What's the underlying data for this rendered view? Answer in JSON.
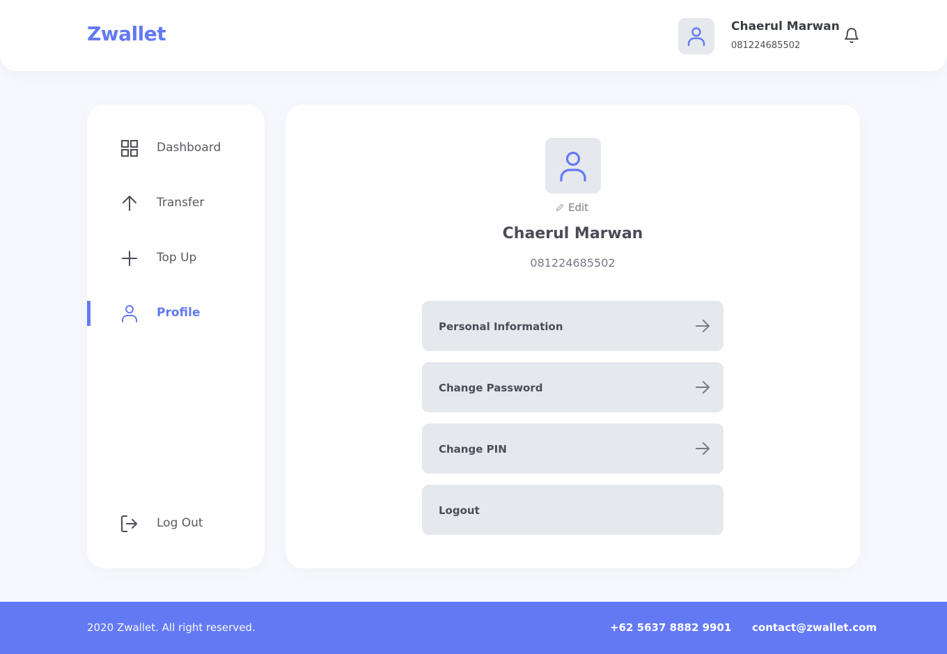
{
  "header": {
    "brand": "Zwallet",
    "user_name": "Chaerul Marwan",
    "user_phone": "081224685502"
  },
  "sidebar": {
    "items": [
      {
        "label": "Dashboard",
        "icon": "grid-icon"
      },
      {
        "label": "Transfer",
        "icon": "arrow-up-icon"
      },
      {
        "label": "Top Up",
        "icon": "plus-icon"
      },
      {
        "label": "Profile",
        "icon": "user-icon",
        "active": true
      }
    ],
    "logout_label": "Log Out"
  },
  "profile": {
    "edit_label": "Edit",
    "name": "Chaerul Marwan",
    "phone": "081224685502",
    "menu": [
      {
        "label": "Personal Information",
        "has_arrow": true
      },
      {
        "label": "Change Password",
        "has_arrow": true
      },
      {
        "label": "Change PIN",
        "has_arrow": true
      },
      {
        "label": "Logout",
        "has_arrow": false
      }
    ]
  },
  "footer": {
    "copyright": "2020 Zwallet. All right reserved.",
    "phone": "+62 5637 8882 9901",
    "email": "contact@zwallet.com"
  },
  "colors": {
    "accent": "#6379F4",
    "background": "#F7F8FD",
    "button_bg": "#E5E8ED"
  }
}
